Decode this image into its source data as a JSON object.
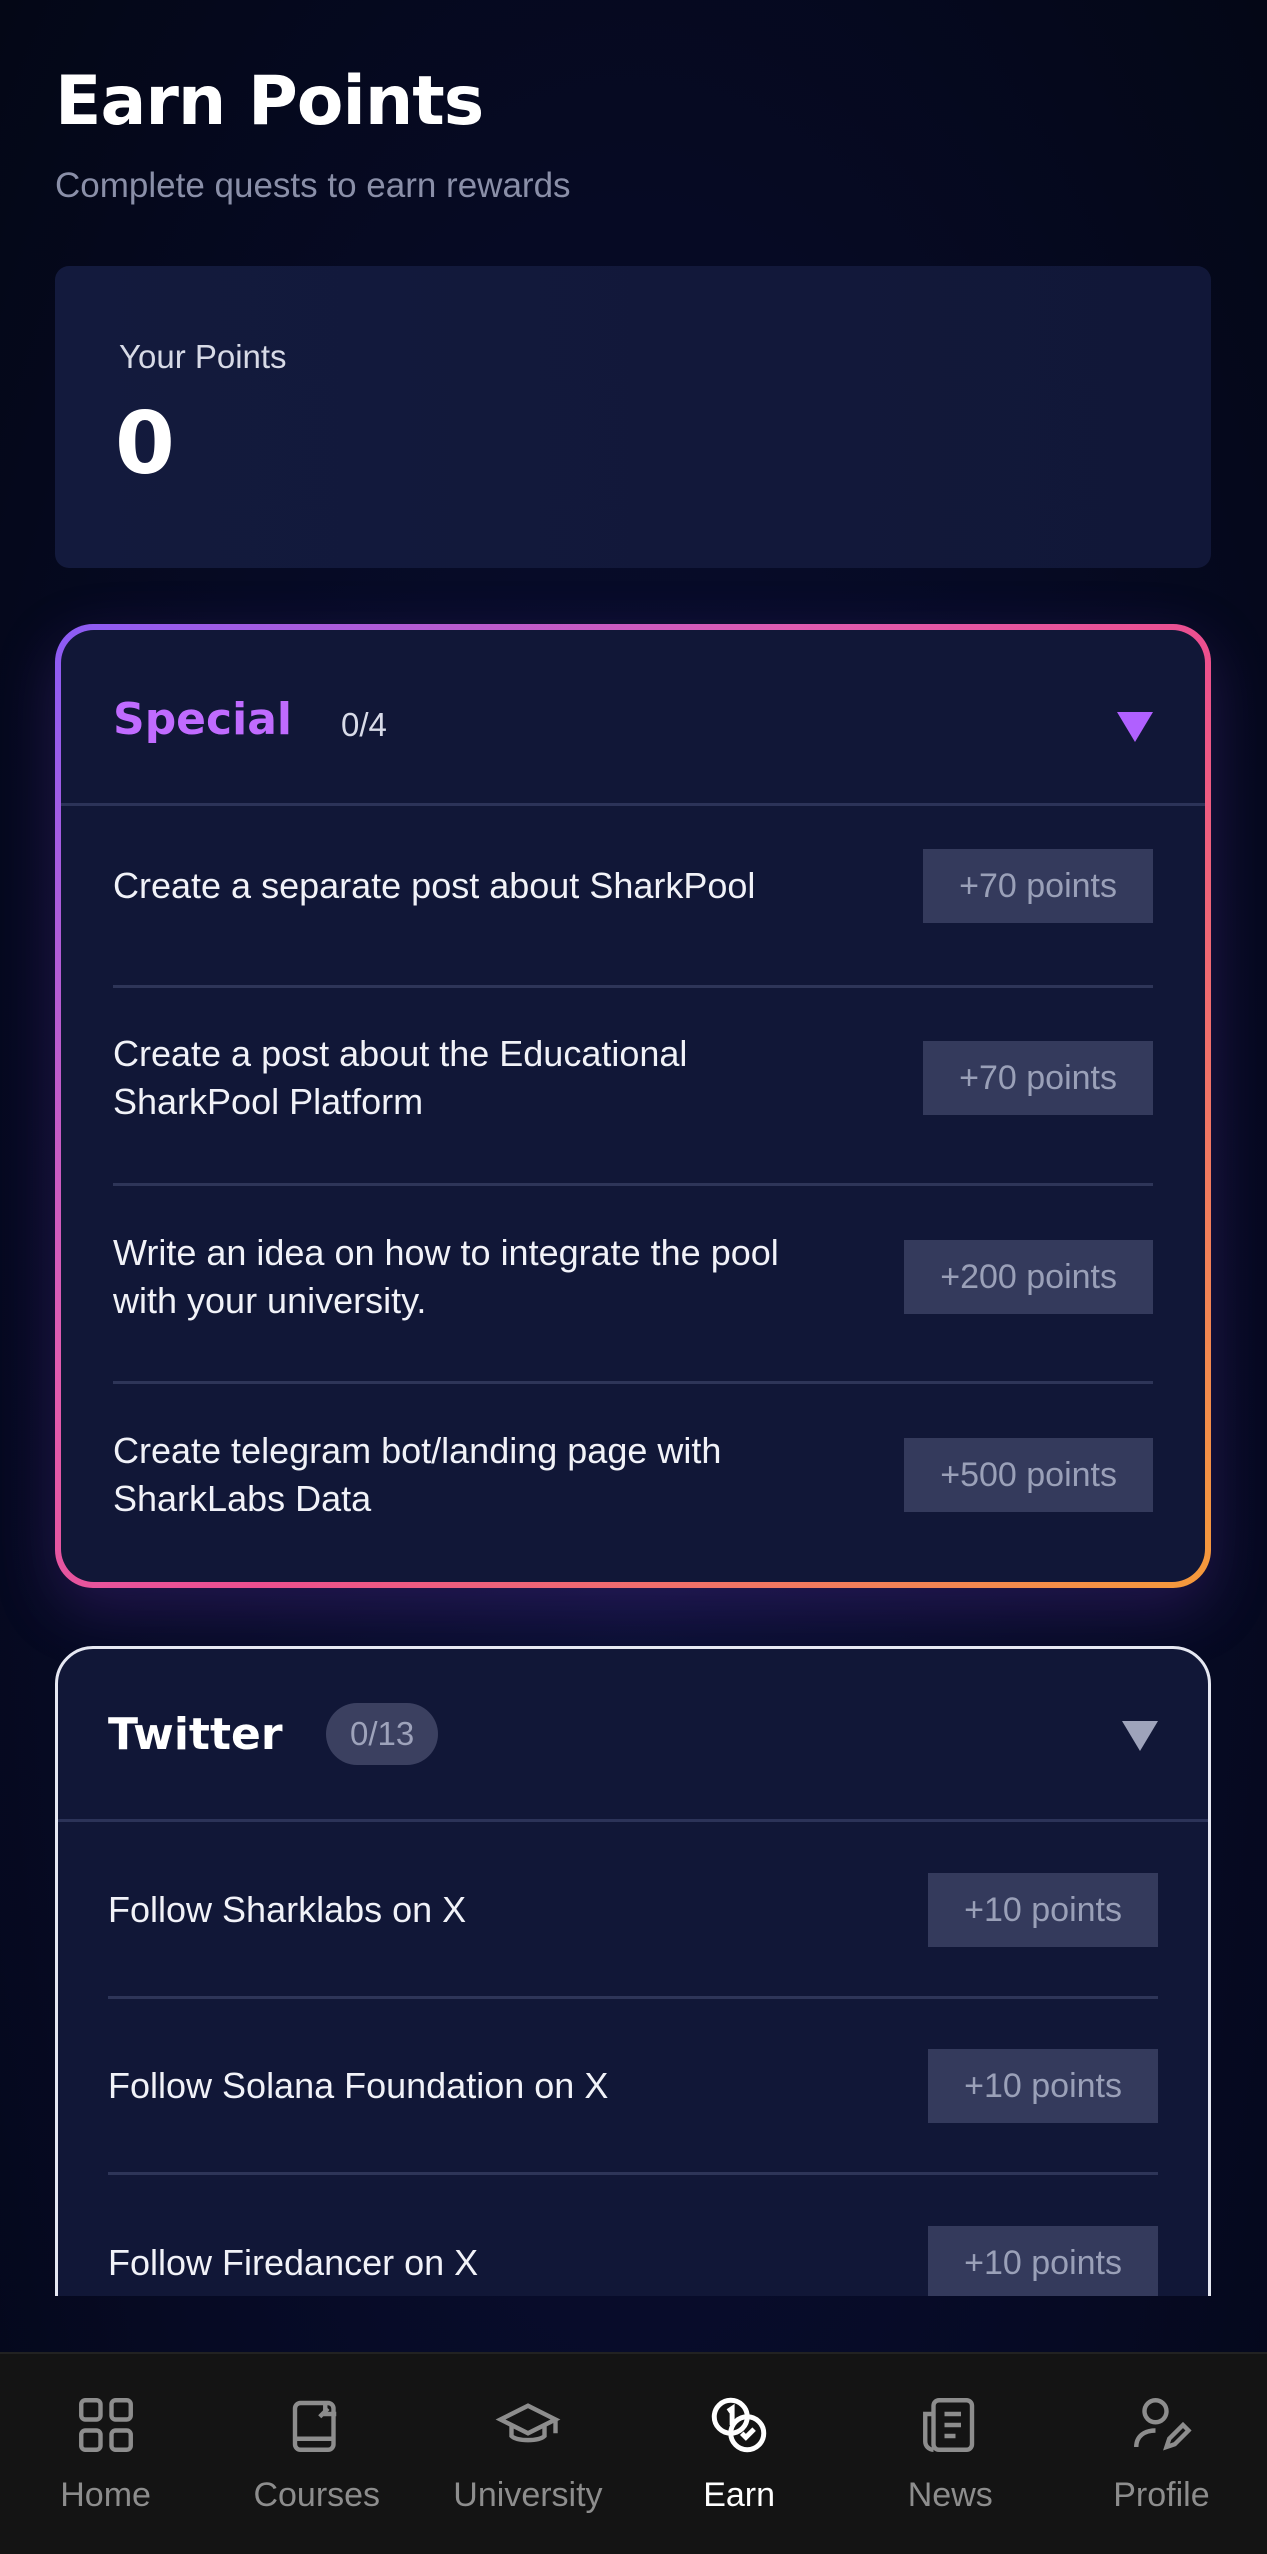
{
  "header": {
    "title": "Earn Points",
    "subtitle": "Complete quests to earn rewards"
  },
  "points_card": {
    "label": "Your Points",
    "value": "0"
  },
  "special": {
    "title": "Special",
    "count": "0/4",
    "quests": [
      {
        "text": "Create a separate post about SharkPool",
        "reward": "+70 points"
      },
      {
        "text": "Create a post about the Educational SharkPool Platform",
        "reward": "+70 points"
      },
      {
        "text": "Write an idea on how to integrate the pool with your university.",
        "reward": "+200 points"
      },
      {
        "text": "Create telegram bot/landing page with SharkLabs Data",
        "reward": "+500 points"
      }
    ]
  },
  "twitter": {
    "title": "Twitter",
    "count": "0/13",
    "quests": [
      {
        "text": "Follow Sharklabs on X",
        "reward": "+10 points"
      },
      {
        "text": "Follow Solana Foundation on X",
        "reward": "+10 points"
      },
      {
        "text": "Follow Firedancer on X",
        "reward": "+10 points"
      }
    ]
  },
  "nav": {
    "items": [
      {
        "label": "Home",
        "icon": "grid-icon"
      },
      {
        "label": "Courses",
        "icon": "book-icon"
      },
      {
        "label": "University",
        "icon": "graduation-cap-icon"
      },
      {
        "label": "Earn",
        "icon": "coins-icon"
      },
      {
        "label": "News",
        "icon": "newspaper-icon"
      },
      {
        "label": "Profile",
        "icon": "user-edit-icon"
      }
    ],
    "active": "Earn"
  },
  "colors": {
    "background": "#060a24",
    "card": "#111737",
    "special_accent": "#c06bff",
    "badge_bg": "#343a5c"
  }
}
